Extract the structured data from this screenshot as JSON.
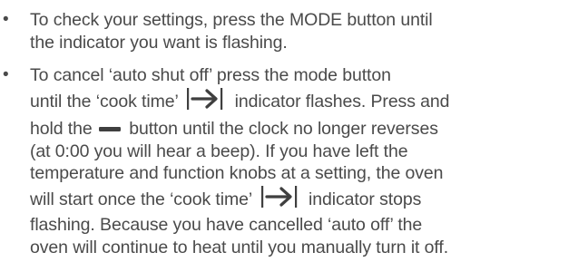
{
  "items": [
    {
      "bullet": "•",
      "lines": [
        "To check your settings, press the MODE button until",
        "the indicator you want is flashing."
      ]
    },
    {
      "bullet": "•",
      "line1": "To cancel ‘auto shut off’ press the mode button",
      "line2_a": "until the ‘cook time’",
      "line2_b": "indicator flashes. Press and",
      "line3_a": "hold the",
      "line3_b": "button until the clock no longer reverses",
      "line4": "(at 0:00 you will hear a beep). If you have left the",
      "line5": "temperature and function knobs at a setting, the oven",
      "line6_a": "will start once the ‘cook time’",
      "line6_b": "indicator stops",
      "line7": "flashing. Because you have cancelled ‘auto off’ the",
      "line8": "oven will continue to heat until you manually turn it off."
    }
  ],
  "icons": {
    "arrow_to_bar": "arrow-to-bar-icon",
    "minus": "minus-icon"
  }
}
